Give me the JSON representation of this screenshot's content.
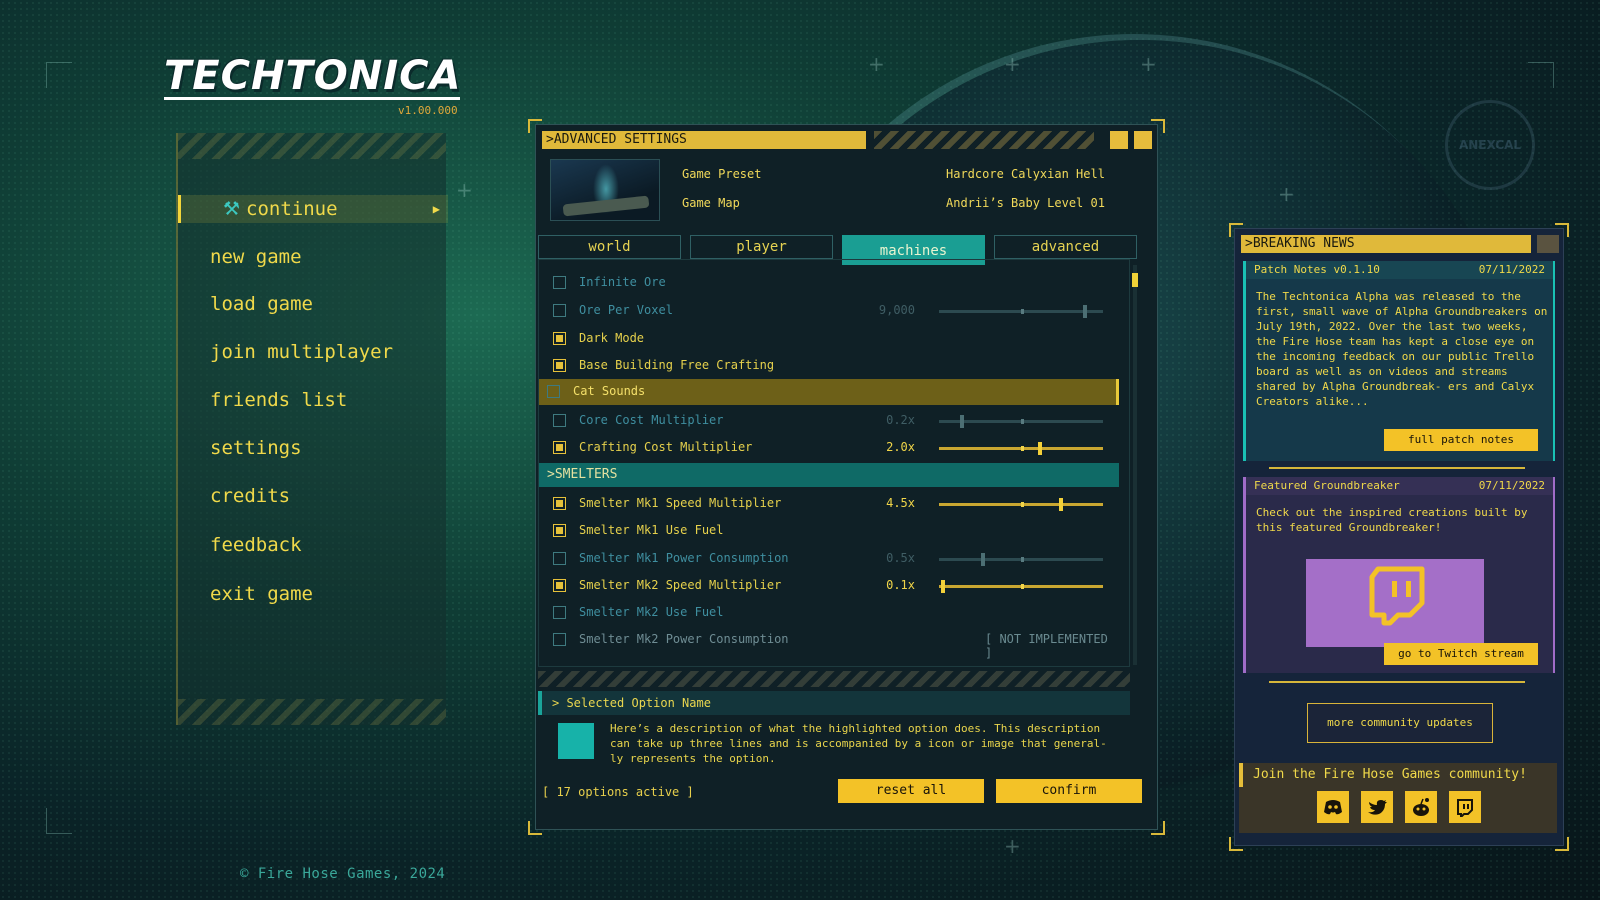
{
  "logo": {
    "text": "TECHTONICA",
    "version": "v1.00.000"
  },
  "menu": {
    "items": [
      "continue",
      "new game",
      "load game",
      "join multiplayer",
      "friends list",
      "settings",
      "credits",
      "feedback",
      "exit game"
    ],
    "active": "continue"
  },
  "copyright": "© Fire Hose Games, 2024",
  "settings": {
    "title": ">ADVANCED SETTINGS",
    "preset_label": "Game Preset",
    "preset_value": "Hardcore Calyxian Hell",
    "map_label": "Game Map",
    "map_value": "Andrii’s Baby Level 01",
    "tabs": [
      "world",
      "player",
      "machines",
      "advanced"
    ],
    "active_tab": "machines",
    "options": [
      {
        "label": "Infinite Ore",
        "checked": false,
        "style": "dim"
      },
      {
        "label": "Ore Per Voxel",
        "checked": false,
        "style": "dim",
        "value": "9,000",
        "level": 0.9
      },
      {
        "label": "Dark Mode",
        "checked": true,
        "style": "normal"
      },
      {
        "label": "Base Building Free Crafting",
        "checked": true,
        "style": "normal"
      },
      {
        "label": "Cat Sounds",
        "checked": false,
        "style": "selected"
      },
      {
        "label": "Core Cost Multiplier",
        "checked": false,
        "style": "dim",
        "value": "0.2x",
        "level": 0.13
      },
      {
        "label": "Crafting Cost Multiplier",
        "checked": true,
        "style": "normal",
        "value": "2.0x",
        "level": 0.62
      }
    ],
    "section": ">SMELTERS",
    "smelter_options": [
      {
        "label": "Smelter Mk1 Speed Multiplier",
        "checked": true,
        "style": "normal",
        "value": "4.5x",
        "level": 0.75
      },
      {
        "label": "Smelter Mk1 Use Fuel",
        "checked": true,
        "style": "normal"
      },
      {
        "label": "Smelter Mk1 Power Consumption",
        "checked": false,
        "style": "dim",
        "value": "0.5x",
        "level": 0.26
      },
      {
        "label": "Smelter Mk2 Speed Multiplier",
        "checked": true,
        "style": "normal",
        "value": "0.1x",
        "level": 0.01
      },
      {
        "label": "Smelter Mk2 Use Fuel",
        "checked": false,
        "style": "dim"
      },
      {
        "label": "Smelter Mk2 Power Consumption",
        "checked": false,
        "style": "gray",
        "note": "[ NOT IMPLEMENTED ]"
      }
    ],
    "desc_title": "> Selected Option Name",
    "desc_text": "Here’s a description of what the highlighted option does. This description can take up three lines and is accompanied by a icon or image that general- ly represents the option.",
    "options_count": "[ 17 options active ]",
    "reset_label": "reset all",
    "confirm_label": "confirm"
  },
  "news": {
    "title": ">BREAKING NEWS",
    "patch": {
      "title": "Patch Notes v0.1.10",
      "date": "07/11/2022",
      "body": "The Techtonica Alpha was released to the first, small wave of Alpha Groundbreakers on July 19th, 2022. Over the last two weeks, the Fire Hose team has kept a close eye on the incoming feedback on our public Trello board as well as on videos and streams shared by Alpha Groundbreak- ers and Calyx Creators alike...",
      "button": "full patch notes"
    },
    "featured": {
      "title": "Featured Groundbreaker",
      "date": "07/11/2022",
      "body": "Check out the inspired creations built by this featured Groundbreaker!",
      "button": "go to Twitch stream"
    },
    "community_button": "more community updates",
    "join_text": "Join the Fire Hose Games community!",
    "socials": [
      "discord-icon",
      "twitter-icon",
      "reddit-icon",
      "twitch-icon"
    ]
  },
  "emblem_text": "ANEXCAL",
  "colors": {
    "accent": "#f3c227",
    "teal": "#1a9e93",
    "purple": "#a46fc8"
  }
}
